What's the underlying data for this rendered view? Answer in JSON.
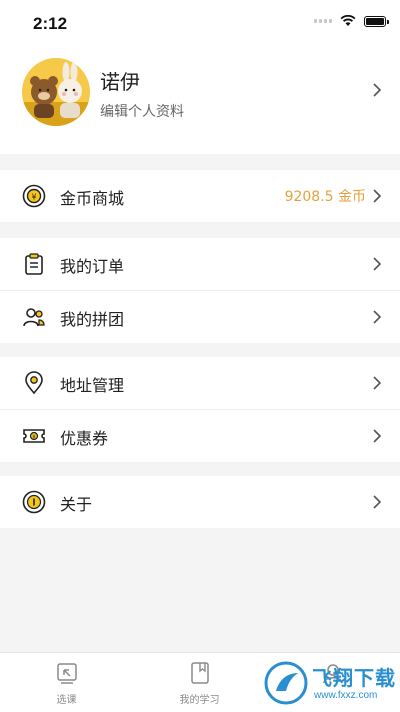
{
  "status_bar": {
    "time": "2:12"
  },
  "profile": {
    "name": "诺伊",
    "subtitle": "编辑个人资料"
  },
  "sections": [
    {
      "items": [
        {
          "label": "金币商城",
          "value": "9208.5 金币",
          "icon": "coin-icon"
        }
      ]
    },
    {
      "items": [
        {
          "label": "我的订单",
          "icon": "clipboard-icon"
        },
        {
          "label": "我的拼团",
          "icon": "group-icon"
        }
      ]
    },
    {
      "items": [
        {
          "label": "地址管理",
          "icon": "location-pin-icon"
        },
        {
          "label": "优惠券",
          "icon": "coupon-icon"
        }
      ]
    },
    {
      "items": [
        {
          "label": "关于",
          "icon": "info-icon"
        }
      ]
    }
  ],
  "tabbar": {
    "tabs": [
      {
        "label": "选课",
        "icon": "select-course-icon"
      },
      {
        "label": "我的学习",
        "icon": "my-study-icon"
      },
      {
        "label": "",
        "icon": "profile-icon"
      }
    ]
  },
  "watermark": {
    "text": "飞翔下载",
    "url": "www.fxxz.com"
  },
  "colors": {
    "accent": "#f5c518",
    "value_orange": "#e6a23c",
    "background": "#f4f4f4"
  }
}
